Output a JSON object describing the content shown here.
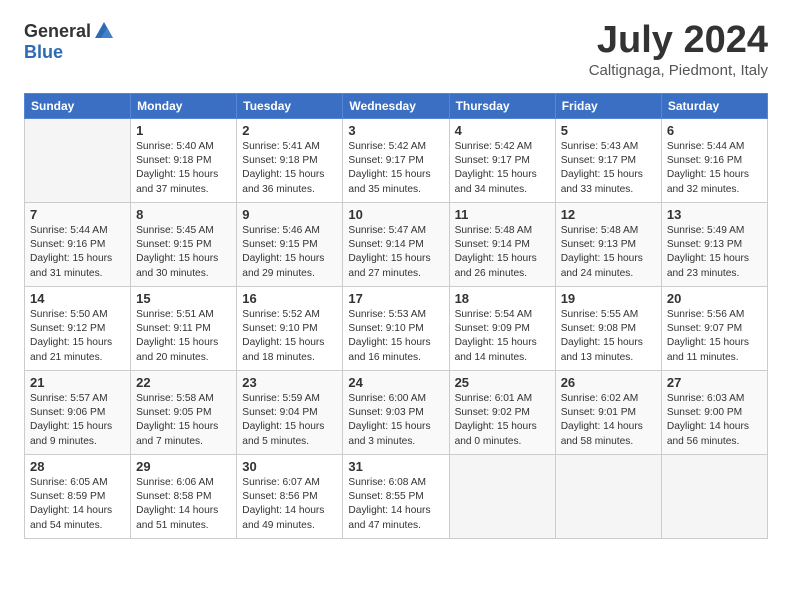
{
  "header": {
    "logo_general": "General",
    "logo_blue": "Blue",
    "month_year": "July 2024",
    "location": "Caltignaga, Piedmont, Italy"
  },
  "weekdays": [
    "Sunday",
    "Monday",
    "Tuesday",
    "Wednesday",
    "Thursday",
    "Friday",
    "Saturday"
  ],
  "weeks": [
    [
      {
        "day": "",
        "sunrise": "",
        "sunset": "",
        "daylight": ""
      },
      {
        "day": "1",
        "sunrise": "Sunrise: 5:40 AM",
        "sunset": "Sunset: 9:18 PM",
        "daylight": "Daylight: 15 hours and 37 minutes."
      },
      {
        "day": "2",
        "sunrise": "Sunrise: 5:41 AM",
        "sunset": "Sunset: 9:18 PM",
        "daylight": "Daylight: 15 hours and 36 minutes."
      },
      {
        "day": "3",
        "sunrise": "Sunrise: 5:42 AM",
        "sunset": "Sunset: 9:17 PM",
        "daylight": "Daylight: 15 hours and 35 minutes."
      },
      {
        "day": "4",
        "sunrise": "Sunrise: 5:42 AM",
        "sunset": "Sunset: 9:17 PM",
        "daylight": "Daylight: 15 hours and 34 minutes."
      },
      {
        "day": "5",
        "sunrise": "Sunrise: 5:43 AM",
        "sunset": "Sunset: 9:17 PM",
        "daylight": "Daylight: 15 hours and 33 minutes."
      },
      {
        "day": "6",
        "sunrise": "Sunrise: 5:44 AM",
        "sunset": "Sunset: 9:16 PM",
        "daylight": "Daylight: 15 hours and 32 minutes."
      }
    ],
    [
      {
        "day": "7",
        "sunrise": "Sunrise: 5:44 AM",
        "sunset": "Sunset: 9:16 PM",
        "daylight": "Daylight: 15 hours and 31 minutes."
      },
      {
        "day": "8",
        "sunrise": "Sunrise: 5:45 AM",
        "sunset": "Sunset: 9:15 PM",
        "daylight": "Daylight: 15 hours and 30 minutes."
      },
      {
        "day": "9",
        "sunrise": "Sunrise: 5:46 AM",
        "sunset": "Sunset: 9:15 PM",
        "daylight": "Daylight: 15 hours and 29 minutes."
      },
      {
        "day": "10",
        "sunrise": "Sunrise: 5:47 AM",
        "sunset": "Sunset: 9:14 PM",
        "daylight": "Daylight: 15 hours and 27 minutes."
      },
      {
        "day": "11",
        "sunrise": "Sunrise: 5:48 AM",
        "sunset": "Sunset: 9:14 PM",
        "daylight": "Daylight: 15 hours and 26 minutes."
      },
      {
        "day": "12",
        "sunrise": "Sunrise: 5:48 AM",
        "sunset": "Sunset: 9:13 PM",
        "daylight": "Daylight: 15 hours and 24 minutes."
      },
      {
        "day": "13",
        "sunrise": "Sunrise: 5:49 AM",
        "sunset": "Sunset: 9:13 PM",
        "daylight": "Daylight: 15 hours and 23 minutes."
      }
    ],
    [
      {
        "day": "14",
        "sunrise": "Sunrise: 5:50 AM",
        "sunset": "Sunset: 9:12 PM",
        "daylight": "Daylight: 15 hours and 21 minutes."
      },
      {
        "day": "15",
        "sunrise": "Sunrise: 5:51 AM",
        "sunset": "Sunset: 9:11 PM",
        "daylight": "Daylight: 15 hours and 20 minutes."
      },
      {
        "day": "16",
        "sunrise": "Sunrise: 5:52 AM",
        "sunset": "Sunset: 9:10 PM",
        "daylight": "Daylight: 15 hours and 18 minutes."
      },
      {
        "day": "17",
        "sunrise": "Sunrise: 5:53 AM",
        "sunset": "Sunset: 9:10 PM",
        "daylight": "Daylight: 15 hours and 16 minutes."
      },
      {
        "day": "18",
        "sunrise": "Sunrise: 5:54 AM",
        "sunset": "Sunset: 9:09 PM",
        "daylight": "Daylight: 15 hours and 14 minutes."
      },
      {
        "day": "19",
        "sunrise": "Sunrise: 5:55 AM",
        "sunset": "Sunset: 9:08 PM",
        "daylight": "Daylight: 15 hours and 13 minutes."
      },
      {
        "day": "20",
        "sunrise": "Sunrise: 5:56 AM",
        "sunset": "Sunset: 9:07 PM",
        "daylight": "Daylight: 15 hours and 11 minutes."
      }
    ],
    [
      {
        "day": "21",
        "sunrise": "Sunrise: 5:57 AM",
        "sunset": "Sunset: 9:06 PM",
        "daylight": "Daylight: 15 hours and 9 minutes."
      },
      {
        "day": "22",
        "sunrise": "Sunrise: 5:58 AM",
        "sunset": "Sunset: 9:05 PM",
        "daylight": "Daylight: 15 hours and 7 minutes."
      },
      {
        "day": "23",
        "sunrise": "Sunrise: 5:59 AM",
        "sunset": "Sunset: 9:04 PM",
        "daylight": "Daylight: 15 hours and 5 minutes."
      },
      {
        "day": "24",
        "sunrise": "Sunrise: 6:00 AM",
        "sunset": "Sunset: 9:03 PM",
        "daylight": "Daylight: 15 hours and 3 minutes."
      },
      {
        "day": "25",
        "sunrise": "Sunrise: 6:01 AM",
        "sunset": "Sunset: 9:02 PM",
        "daylight": "Daylight: 15 hours and 0 minutes."
      },
      {
        "day": "26",
        "sunrise": "Sunrise: 6:02 AM",
        "sunset": "Sunset: 9:01 PM",
        "daylight": "Daylight: 14 hours and 58 minutes."
      },
      {
        "day": "27",
        "sunrise": "Sunrise: 6:03 AM",
        "sunset": "Sunset: 9:00 PM",
        "daylight": "Daylight: 14 hours and 56 minutes."
      }
    ],
    [
      {
        "day": "28",
        "sunrise": "Sunrise: 6:05 AM",
        "sunset": "Sunset: 8:59 PM",
        "daylight": "Daylight: 14 hours and 54 minutes."
      },
      {
        "day": "29",
        "sunrise": "Sunrise: 6:06 AM",
        "sunset": "Sunset: 8:58 PM",
        "daylight": "Daylight: 14 hours and 51 minutes."
      },
      {
        "day": "30",
        "sunrise": "Sunrise: 6:07 AM",
        "sunset": "Sunset: 8:56 PM",
        "daylight": "Daylight: 14 hours and 49 minutes."
      },
      {
        "day": "31",
        "sunrise": "Sunrise: 6:08 AM",
        "sunset": "Sunset: 8:55 PM",
        "daylight": "Daylight: 14 hours and 47 minutes."
      },
      {
        "day": "",
        "sunrise": "",
        "sunset": "",
        "daylight": ""
      },
      {
        "day": "",
        "sunrise": "",
        "sunset": "",
        "daylight": ""
      },
      {
        "day": "",
        "sunrise": "",
        "sunset": "",
        "daylight": ""
      }
    ]
  ]
}
